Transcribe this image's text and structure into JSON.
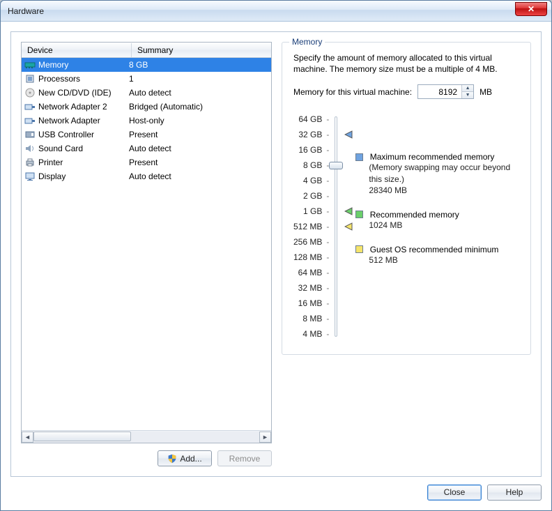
{
  "window": {
    "title": "Hardware"
  },
  "list": {
    "headers": {
      "device": "Device",
      "summary": "Summary"
    },
    "rows": [
      {
        "icon": "memory",
        "device": "Memory",
        "summary": "8 GB",
        "selected": true
      },
      {
        "icon": "cpu",
        "device": "Processors",
        "summary": "1",
        "selected": false
      },
      {
        "icon": "disc",
        "device": "New CD/DVD (IDE)",
        "summary": "Auto detect",
        "selected": false
      },
      {
        "icon": "nic",
        "device": "Network Adapter 2",
        "summary": "Bridged (Automatic)",
        "selected": false
      },
      {
        "icon": "nic",
        "device": "Network Adapter",
        "summary": "Host-only",
        "selected": false
      },
      {
        "icon": "usb",
        "device": "USB Controller",
        "summary": "Present",
        "selected": false
      },
      {
        "icon": "sound",
        "device": "Sound Card",
        "summary": "Auto detect",
        "selected": false
      },
      {
        "icon": "printer",
        "device": "Printer",
        "summary": "Present",
        "selected": false
      },
      {
        "icon": "display",
        "device": "Display",
        "summary": "Auto detect",
        "selected": false
      }
    ]
  },
  "buttons": {
    "add": "Add...",
    "remove": "Remove",
    "close": "Close",
    "help": "Help"
  },
  "memory_panel": {
    "title": "Memory",
    "desc": "Specify the amount of memory allocated to this virtual machine. The memory size must be a multiple of 4 MB.",
    "field_label": "Memory for this virtual machine:",
    "field_value": "8192",
    "field_unit": "MB",
    "scale": [
      "64 GB",
      "32 GB",
      "16 GB",
      "8 GB",
      "4 GB",
      "2 GB",
      "1 GB",
      "512 MB",
      "256 MB",
      "128 MB",
      "64 MB",
      "32 MB",
      "16 MB",
      "8 MB",
      "4 MB"
    ],
    "thumb_index": 3,
    "markers": {
      "max_index": 1,
      "rec_index": 6,
      "min_index": 7
    },
    "legend": {
      "max_title": "Maximum recommended memory",
      "max_note": "(Memory swapping may occur beyond this size.)",
      "max_value": "28340 MB",
      "rec_title": "Recommended memory",
      "rec_value": "1024 MB",
      "min_title": "Guest OS recommended minimum",
      "min_value": "512 MB"
    }
  }
}
